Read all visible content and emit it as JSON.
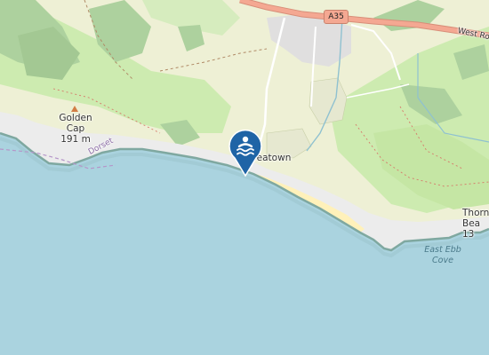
{
  "map": {
    "labels": {
      "road_shield": "A35",
      "road_name": "West Ro",
      "peak_name": "Golden",
      "peak_name_2": "Cap",
      "peak_elevation": "191 m",
      "region": "Dorset",
      "village": "Seatown",
      "thorn_line1": "Thorn",
      "thorn_line2": "Bea",
      "thorn_line3": "13",
      "cove_line1": "East Ebb",
      "cove_line2": "Cove"
    },
    "marker": {
      "icon": "swimming-icon",
      "color": "#1f64a6"
    },
    "colors": {
      "sea": "#aad3df",
      "farmland": "#eef0d5",
      "meadow": "#cdebb0",
      "wood": "#add19e",
      "beach": "#fff1ba",
      "cliff": "#ececec",
      "road_primary": "#f4a892",
      "residential": "#e0dfdf"
    }
  }
}
